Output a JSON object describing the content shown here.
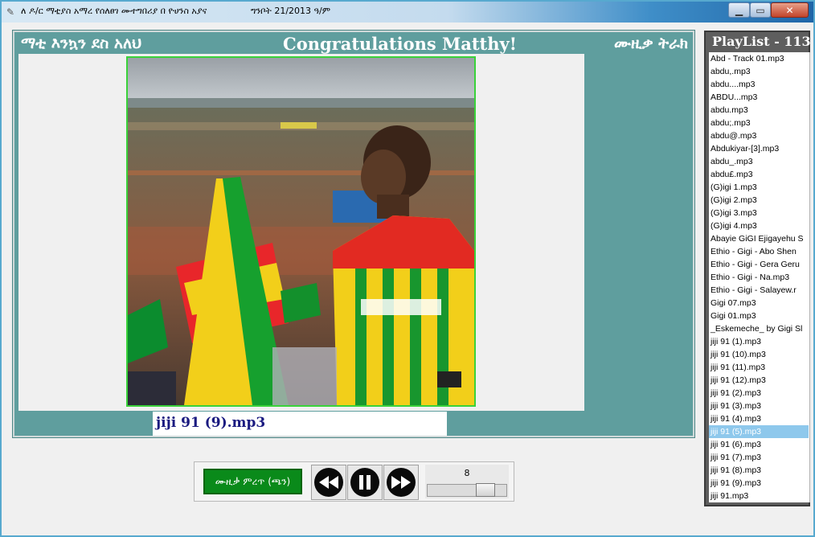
{
  "window": {
    "title": "ለ ዶ/ር ማቲያስ አማረ የሰለፀገ ሙተግበሪያ   በ ዮሀንስ አያና",
    "date": "ግንቦት 21/2013 ዓ/ም",
    "minimize_glyph": "▁",
    "maximize_glyph": "▭",
    "close_glyph": "✕",
    "app_icon": "feather-icon"
  },
  "header": {
    "left": "ማቲ እንኳን ደስ አለህ",
    "center": "Congratulations Matthy!",
    "right": "ሙዚቃ ትራክ"
  },
  "now_playing": "jiji 91 (9).mp3",
  "controls": {
    "play_label": "ሙዚቃ ምረጥ (ጫን)",
    "rewind_icon": "rewind-icon",
    "pause_icon": "pause-icon",
    "forward_icon": "fast-forward-icon",
    "volume_value": "8",
    "volume_fraction": 0.8
  },
  "playlist": {
    "title": "PlayList - 113",
    "selected_index": 29,
    "items": [
      "Abd - Track 01.mp3",
      "abdu,.mp3",
      "abdu....mp3",
      "ABDU...mp3",
      "abdu.mp3",
      "abdu;.mp3",
      "abdu@.mp3",
      "Abdukiyar-[3].mp3",
      "abdu_.mp3",
      "abdu£.mp3",
      "(G)igi 1.mp3",
      "(G)igi 2.mp3",
      "(G)igi 3.mp3",
      "(G)igi 4.mp3",
      "Abayie GiGI Ejigayehu S",
      "Ethio - Gigi - Abo Shen",
      "Ethio - Gigi - Gera Geru",
      "Ethio - Gigi - Na.mp3",
      "Ethio - Gigi - Salayew.r",
      "Gigi  07.mp3",
      "Gigi 01.mp3",
      "_Eskemeche_ by Gigi Sl",
      "jiji 91 (1).mp3",
      "jiji 91 (10).mp3",
      "jiji 91 (11).mp3",
      "jiji 91 (12).mp3",
      "jiji 91 (2).mp3",
      "jiji 91 (3).mp3",
      "jiji 91 (4).mp3",
      "jiji 91 (5).mp3",
      "jiji 91 (6).mp3",
      "jiji 91 (7).mp3",
      "jiji 91 (8).mp3",
      "jiji 91 (9).mp3",
      "jiji 91.mp3"
    ]
  },
  "colors": {
    "panel": "#5f9e9e",
    "play_button": "#0a8a1a",
    "selection": "#8ec8ec",
    "now_playing_text": "#1a1a80"
  }
}
